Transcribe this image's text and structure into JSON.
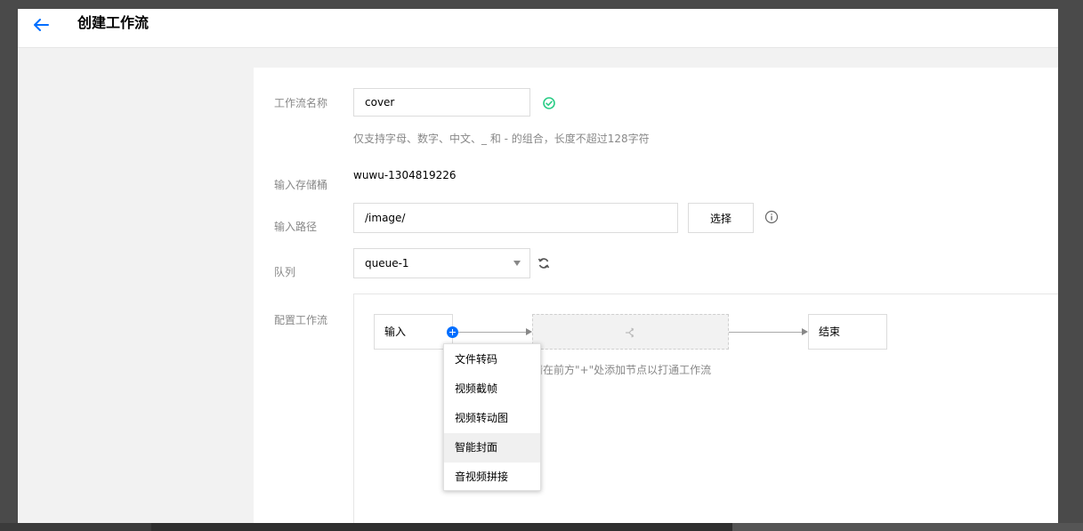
{
  "header": {
    "title": "创建工作流"
  },
  "form": {
    "name": {
      "label": "工作流名称",
      "value": "cover",
      "hint": "仅支持字母、数字、中文、_ 和 - 的组合，长度不超过128字符"
    },
    "bucket": {
      "label": "输入存储桶",
      "value": "wuwu-1304819226"
    },
    "path": {
      "label": "输入路径",
      "value": "/image/",
      "select_button": "选择"
    },
    "queue": {
      "label": "队列",
      "value": "queue-1"
    },
    "workflow": {
      "label": "配置工作流",
      "input_node": "输入",
      "end_node": "结束",
      "hint": "请在前方\"+\"处添加节点以打通工作流"
    }
  },
  "node_menu": {
    "items": [
      {
        "label": "文件转码"
      },
      {
        "label": "视频截帧"
      },
      {
        "label": "视频转动图"
      },
      {
        "label": "智能封面",
        "highlighted": true
      },
      {
        "label": "音视频拼接"
      }
    ]
  },
  "colors": {
    "accent": "#006eff",
    "success": "#29cc85"
  },
  "icons": [
    "back-arrow-icon",
    "check-circle-icon",
    "info-icon",
    "refresh-icon",
    "merge-icon",
    "add-node-icon",
    "caret-down-icon"
  ]
}
